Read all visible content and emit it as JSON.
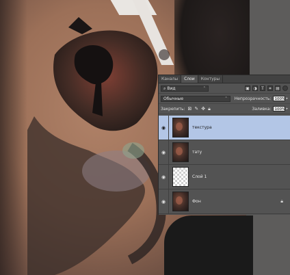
{
  "panel": {
    "tabs": [
      "Каналы",
      "Слои",
      "Контуры"
    ],
    "active_tab": 1,
    "filter": {
      "value": "Вид"
    },
    "blend_mode": "Обычные",
    "opacity_label": "Непрозрачность:",
    "opacity_value": "100%",
    "lock_label": "Закрепить:",
    "fill_label": "Заливка:",
    "fill_value": "100%",
    "layers": [
      {
        "name": "текстура",
        "selected": true,
        "visible": true,
        "thumb": "photo"
      },
      {
        "name": "тату",
        "selected": false,
        "visible": true,
        "thumb": "photo"
      },
      {
        "name": "Слой 1",
        "selected": false,
        "visible": true,
        "thumb": "transparent"
      },
      {
        "name": "Фон",
        "selected": false,
        "visible": true,
        "thumb": "photo",
        "locked": true
      }
    ]
  }
}
